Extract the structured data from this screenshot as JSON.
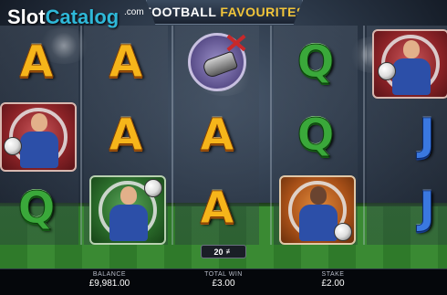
{
  "watermark": {
    "brand_1": "Slot",
    "brand_2": "Catalog",
    "suffix": ".com"
  },
  "game": {
    "title_1": "FOOTBALL",
    "title_2": "FAVOURITES"
  },
  "reels": [
    [
      "A",
      "player-red",
      "Q"
    ],
    [
      "A",
      "A",
      "player-green"
    ],
    [
      "whistle",
      "A",
      "A"
    ],
    [
      "Q",
      "Q",
      "player-orange"
    ],
    [
      "player-red",
      "J",
      "J"
    ]
  ],
  "bet_lines": {
    "value": "20",
    "icon": "lines-icon"
  },
  "footer": {
    "balance": {
      "label": "BALANCE",
      "value": "£9,981.00"
    },
    "total_win": {
      "label": "TOTAL WIN",
      "value": "£3.00"
    },
    "stake": {
      "label": "STAKE",
      "value": "£2.00"
    }
  },
  "colors": {
    "letter_A": "#f6b51a",
    "letter_Q": "#3aa83a",
    "letter_J": "#3a78e0",
    "title_accent": "#f2c53a",
    "brand_accent": "#2fb8d8"
  }
}
